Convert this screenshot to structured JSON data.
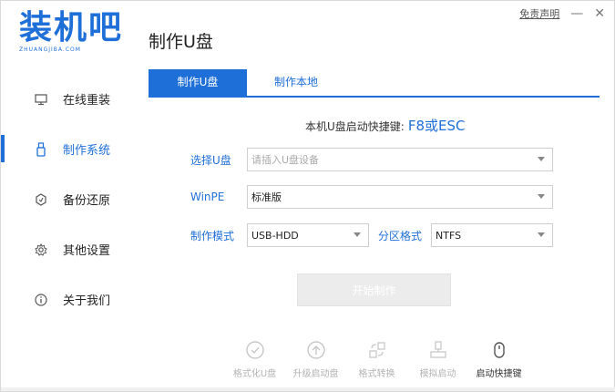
{
  "window": {
    "disclaimer": "免责声明",
    "minimize": "—",
    "close": "✕"
  },
  "logo": {
    "title": "装机吧",
    "subtitle": "ZHUANGJIBA.COM"
  },
  "sidebar": {
    "items": [
      {
        "label": "在线重装",
        "icon": "monitor-icon"
      },
      {
        "label": "制作系统",
        "icon": "usb-icon",
        "active": true
      },
      {
        "label": "备份还原",
        "icon": "backup-icon"
      },
      {
        "label": "其他设置",
        "icon": "gear-icon"
      },
      {
        "label": "关于我们",
        "icon": "info-icon"
      }
    ]
  },
  "main": {
    "title": "制作U盘",
    "tabs": [
      {
        "label": "制作U盘",
        "active": true
      },
      {
        "label": "制作本地",
        "active": false
      }
    ],
    "hotkey_label": "本机U盘启动快捷键:",
    "hotkey_value": "F8或ESC",
    "form": {
      "usb_label": "选择U盘",
      "usb_placeholder": "请插入U盘设备",
      "winpe_label": "WinPE",
      "winpe_value": "标准版",
      "mode_label": "制作模式",
      "mode_value": "USB-HDD",
      "partition_label": "分区格式",
      "partition_value": "NTFS"
    },
    "start_button": "开始制作",
    "tools": [
      {
        "label": "格式化U盘",
        "icon": "check-circle-icon",
        "active": false
      },
      {
        "label": "升级启动盘",
        "icon": "upgrade-icon",
        "active": false
      },
      {
        "label": "格式转换",
        "icon": "convert-icon",
        "active": false
      },
      {
        "label": "模拟启动",
        "icon": "simulate-icon",
        "active": false
      },
      {
        "label": "启动快捷键",
        "icon": "mouse-icon",
        "active": true
      }
    ]
  },
  "colors": {
    "accent": "#1f6fd9",
    "muted": "#b3b3b3"
  }
}
